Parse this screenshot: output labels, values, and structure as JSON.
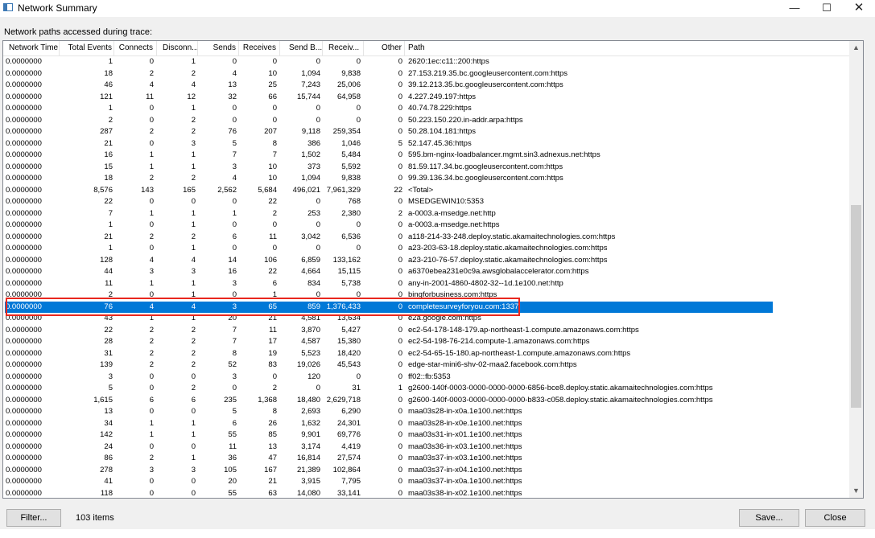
{
  "window": {
    "title": "Network Summary",
    "app_icon": "window-app-icon",
    "controls": {
      "minimize": "—",
      "maximize": "☐",
      "close": "✕"
    }
  },
  "caption": "Network paths accessed during trace:",
  "columns": [
    "Network Time",
    "Total Events",
    "Connects",
    "Disconn...",
    "Sends",
    "Receives",
    "Send B...",
    "Receiv...",
    "Other",
    "Path"
  ],
  "rows": [
    [
      "0.0000000",
      "1",
      "0",
      "1",
      "0",
      "0",
      "0",
      "0",
      "0",
      "2620:1ec:c11::200:https"
    ],
    [
      "0.0000000",
      "18",
      "2",
      "2",
      "4",
      "10",
      "1,094",
      "9,838",
      "0",
      "27.153.219.35.bc.googleusercontent.com:https"
    ],
    [
      "0.0000000",
      "46",
      "4",
      "4",
      "13",
      "25",
      "7,243",
      "25,006",
      "0",
      "39.12.213.35.bc.googleusercontent.com:https"
    ],
    [
      "0.0000000",
      "121",
      "11",
      "12",
      "32",
      "66",
      "15,744",
      "64,958",
      "0",
      "4.227.249.197:https"
    ],
    [
      "0.0000000",
      "1",
      "0",
      "1",
      "0",
      "0",
      "0",
      "0",
      "0",
      "40.74.78.229:https"
    ],
    [
      "0.0000000",
      "2",
      "0",
      "2",
      "0",
      "0",
      "0",
      "0",
      "0",
      "50.223.150.220.in-addr.arpa:https"
    ],
    [
      "0.0000000",
      "287",
      "2",
      "2",
      "76",
      "207",
      "9,118",
      "259,354",
      "0",
      "50.28.104.181:https"
    ],
    [
      "0.0000000",
      "21",
      "0",
      "3",
      "5",
      "8",
      "386",
      "1,046",
      "5",
      "52.147.45.36:https"
    ],
    [
      "0.0000000",
      "16",
      "1",
      "1",
      "7",
      "7",
      "1,502",
      "5,484",
      "0",
      "595.bm-nginx-loadbalancer.mgmt.sin3.adnexus.net:https"
    ],
    [
      "0.0000000",
      "15",
      "1",
      "1",
      "3",
      "10",
      "373",
      "5,592",
      "0",
      "81.59.117.34.bc.googleusercontent.com:https"
    ],
    [
      "0.0000000",
      "18",
      "2",
      "2",
      "4",
      "10",
      "1,094",
      "9,838",
      "0",
      "99.39.136.34.bc.googleusercontent.com:https"
    ],
    [
      "0.0000000",
      "8,576",
      "143",
      "165",
      "2,562",
      "5,684",
      "496,021",
      "7,961,329",
      "22",
      "<Total>"
    ],
    [
      "0.0000000",
      "22",
      "0",
      "0",
      "0",
      "22",
      "0",
      "768",
      "0",
      "MSEDGEWIN10:5353"
    ],
    [
      "0.0000000",
      "7",
      "1",
      "1",
      "1",
      "2",
      "253",
      "2,380",
      "2",
      "a-0003.a-msedge.net:http"
    ],
    [
      "0.0000000",
      "1",
      "0",
      "1",
      "0",
      "0",
      "0",
      "0",
      "0",
      "a-0003.a-msedge.net:https"
    ],
    [
      "0.0000000",
      "21",
      "2",
      "2",
      "6",
      "11",
      "3,042",
      "6,536",
      "0",
      "a118-214-33-248.deploy.static.akamaitechnologies.com:https"
    ],
    [
      "0.0000000",
      "1",
      "0",
      "1",
      "0",
      "0",
      "0",
      "0",
      "0",
      "a23-203-63-18.deploy.static.akamaitechnologies.com:https"
    ],
    [
      "0.0000000",
      "128",
      "4",
      "4",
      "14",
      "106",
      "6,859",
      "133,162",
      "0",
      "a23-210-76-57.deploy.static.akamaitechnologies.com:https"
    ],
    [
      "0.0000000",
      "44",
      "3",
      "3",
      "16",
      "22",
      "4,664",
      "15,115",
      "0",
      "a6370ebea231e0c9a.awsglobalaccelerator.com:https"
    ],
    [
      "0.0000000",
      "11",
      "1",
      "1",
      "3",
      "6",
      "834",
      "5,738",
      "0",
      "any-in-2001-4860-4802-32--1d.1e100.net:http"
    ],
    [
      "0.0000000",
      "2",
      "0",
      "1",
      "0",
      "1",
      "0",
      "0",
      "0",
      "bingforbusiness.com:https"
    ],
    [
      "0.0000000",
      "76",
      "4",
      "4",
      "3",
      "65",
      "859",
      "1,376,433",
      "0",
      "completesurveyforyou.com:1337"
    ],
    [
      "0.0000000",
      "43",
      "1",
      "1",
      "20",
      "21",
      "4,581",
      "13,634",
      "0",
      "e2a.google.com:https"
    ],
    [
      "0.0000000",
      "22",
      "2",
      "2",
      "7",
      "11",
      "3,870",
      "5,427",
      "0",
      "ec2-54-178-148-179.ap-northeast-1.compute.amazonaws.com:https"
    ],
    [
      "0.0000000",
      "28",
      "2",
      "2",
      "7",
      "17",
      "4,587",
      "15,380",
      "0",
      "ec2-54-198-76-214.compute-1.amazonaws.com:https"
    ],
    [
      "0.0000000",
      "31",
      "2",
      "2",
      "8",
      "19",
      "5,523",
      "18,420",
      "0",
      "ec2-54-65-15-180.ap-northeast-1.compute.amazonaws.com:https"
    ],
    [
      "0.0000000",
      "139",
      "2",
      "2",
      "52",
      "83",
      "19,026",
      "45,543",
      "0",
      "edge-star-mini6-shv-02-maa2.facebook.com:https"
    ],
    [
      "0.0000000",
      "3",
      "0",
      "0",
      "3",
      "0",
      "120",
      "0",
      "0",
      "ff02::fb:5353"
    ],
    [
      "0.0000000",
      "5",
      "0",
      "2",
      "0",
      "2",
      "0",
      "31",
      "1",
      "g2600-140f-0003-0000-0000-0000-6856-bce8.deploy.static.akamaitechnologies.com:https"
    ],
    [
      "0.0000000",
      "1,615",
      "6",
      "6",
      "235",
      "1,368",
      "18,480",
      "2,629,718",
      "0",
      "g2600-140f-0003-0000-0000-0000-b833-c058.deploy.static.akamaitechnologies.com:https"
    ],
    [
      "0.0000000",
      "13",
      "0",
      "0",
      "5",
      "8",
      "2,693",
      "6,290",
      "0",
      "maa03s28-in-x0a.1e100.net:https"
    ],
    [
      "0.0000000",
      "34",
      "1",
      "1",
      "6",
      "26",
      "1,632",
      "24,301",
      "0",
      "maa03s28-in-x0e.1e100.net:https"
    ],
    [
      "0.0000000",
      "142",
      "1",
      "1",
      "55",
      "85",
      "9,901",
      "69,776",
      "0",
      "maa03s31-in-x01.1e100.net:https"
    ],
    [
      "0.0000000",
      "24",
      "0",
      "0",
      "11",
      "13",
      "3,174",
      "4,419",
      "0",
      "maa03s36-in-x03.1e100.net:https"
    ],
    [
      "0.0000000",
      "86",
      "2",
      "1",
      "36",
      "47",
      "16,814",
      "27,574",
      "0",
      "maa03s37-in-x03.1e100.net:https"
    ],
    [
      "0.0000000",
      "278",
      "3",
      "3",
      "105",
      "167",
      "21,389",
      "102,864",
      "0",
      "maa03s37-in-x04.1e100.net:https"
    ],
    [
      "0.0000000",
      "41",
      "0",
      "0",
      "20",
      "21",
      "3,915",
      "7,795",
      "0",
      "maa03s37-in-x0a.1e100.net:https"
    ],
    [
      "0.0000000",
      "118",
      "0",
      "0",
      "55",
      "63",
      "14,080",
      "33,141",
      "0",
      "maa03s38-in-x02.1e100.net:https"
    ]
  ],
  "selected_row": 21,
  "scrollbar": {
    "up_icon": "▲",
    "down_icon": "▼"
  },
  "footer": {
    "filter_label": "Filter...",
    "item_count": "103 items",
    "save_label": "Save...",
    "close_label": "Close"
  },
  "colors": {
    "selection": "#0078d7",
    "annotation_box": "#e8271e"
  }
}
